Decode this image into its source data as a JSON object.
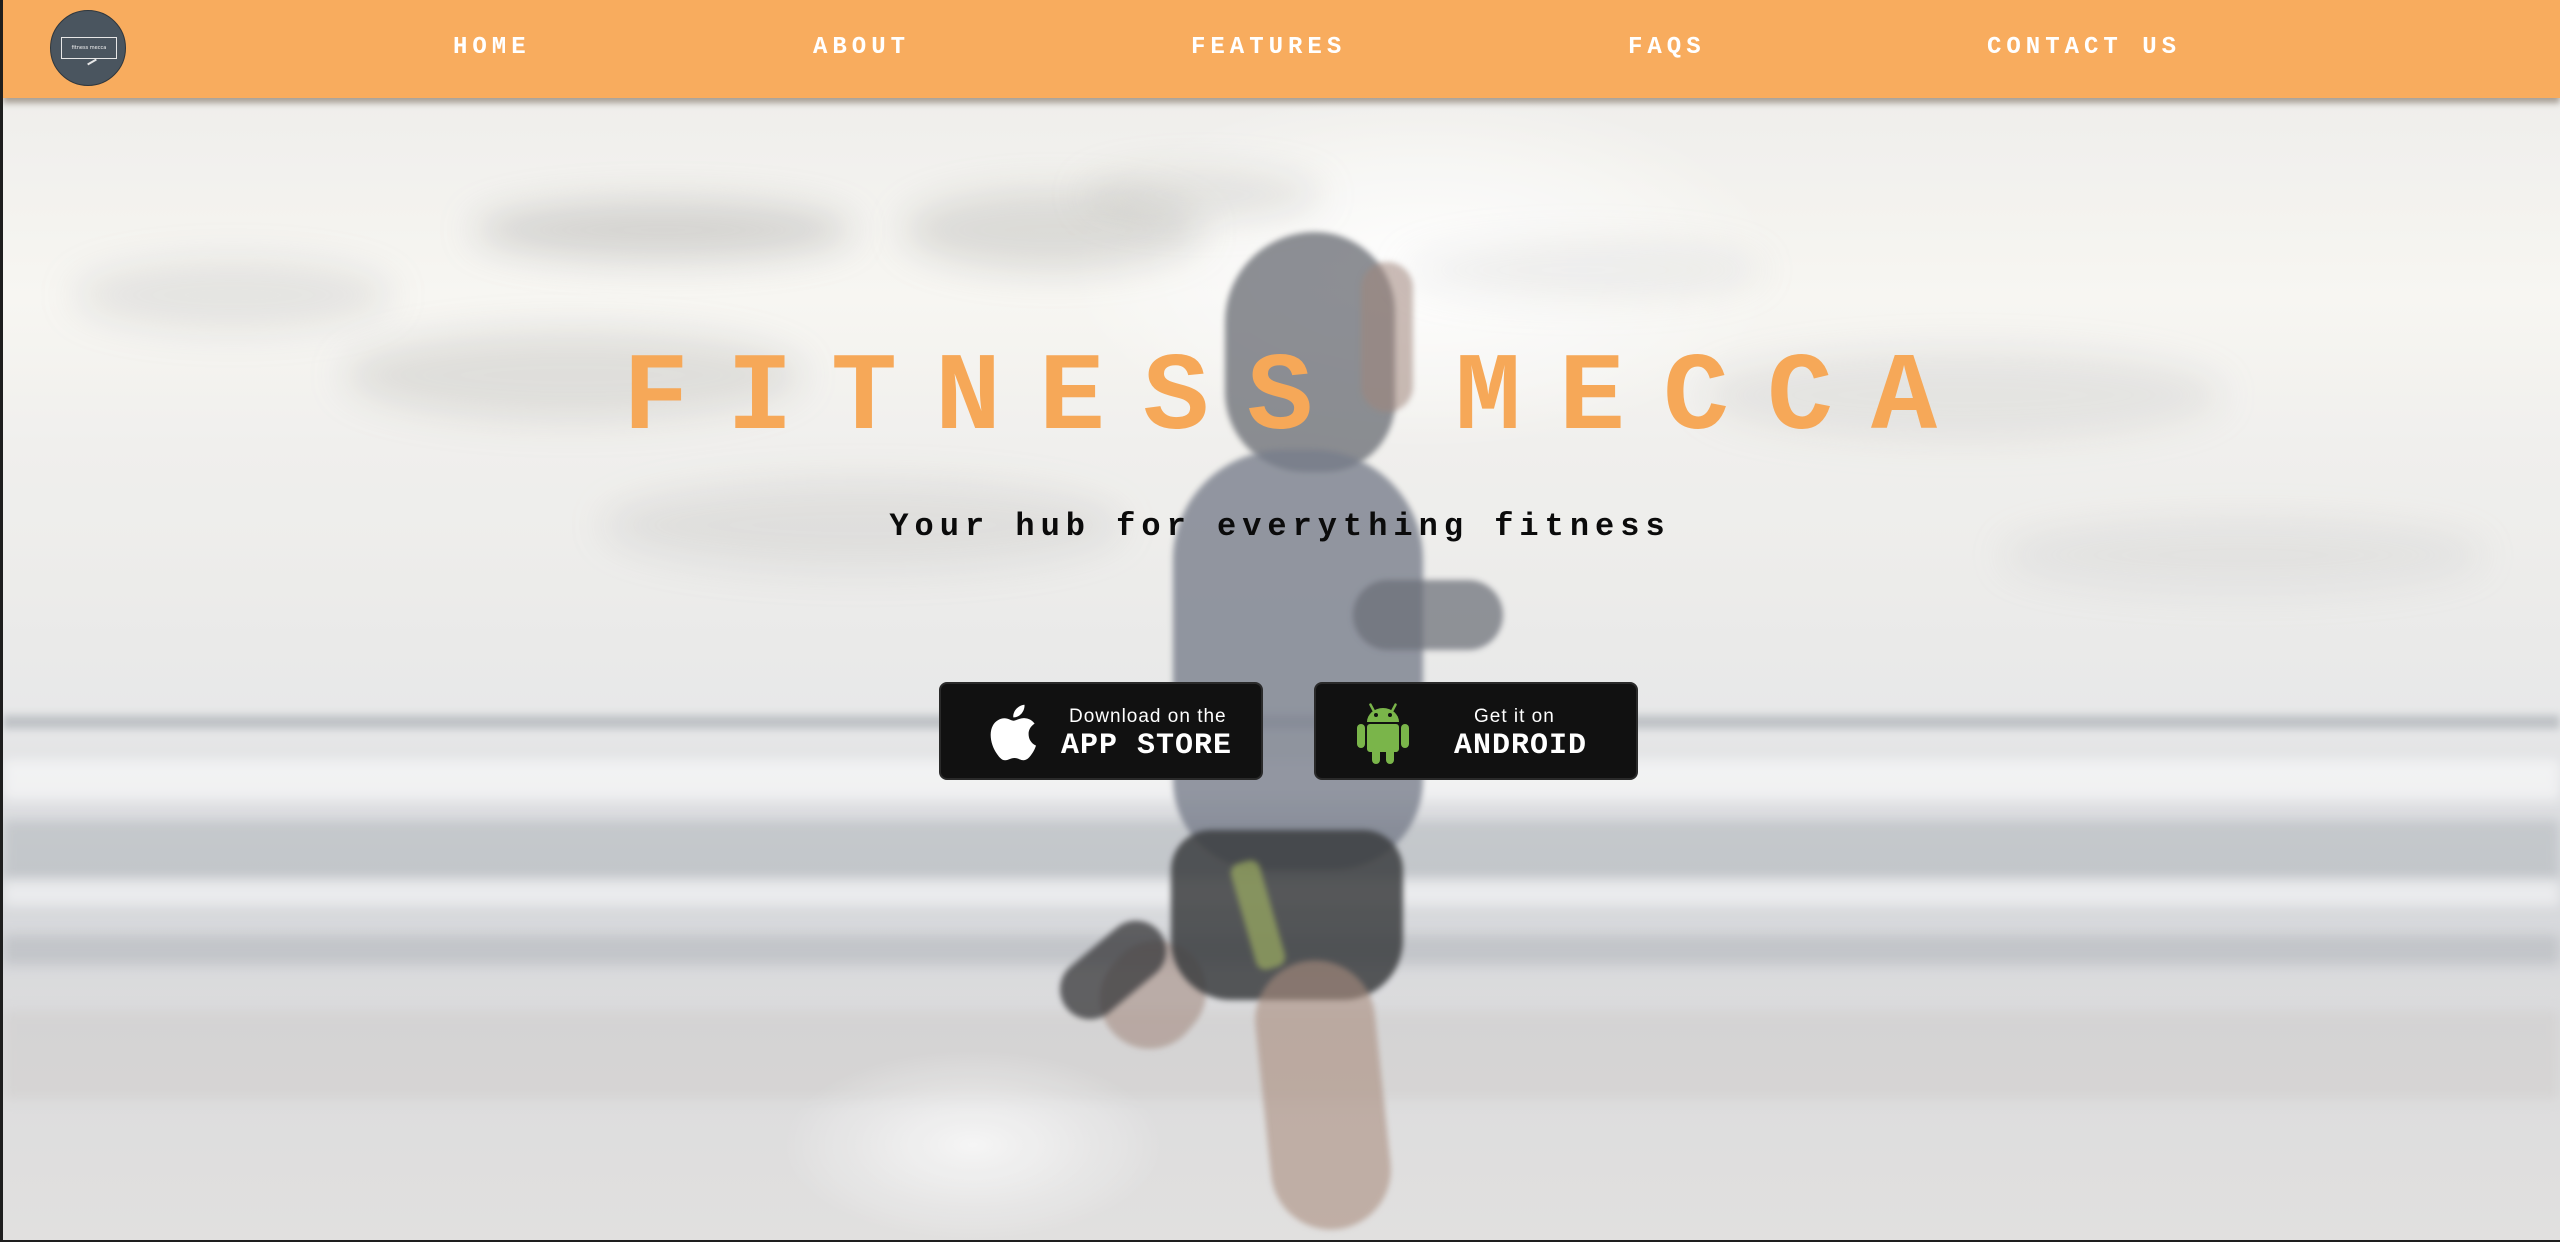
{
  "colors": {
    "navbar_bg": "#f8ac5e",
    "title_color": "#f6a858",
    "subtitle_color": "#0b0b0b",
    "badge_bg": "#111111",
    "android_green": "#7ab54a",
    "logo_bg": "#4a555f"
  },
  "navbar": {
    "logo": {
      "icon": "logo-icon",
      "text": "fitness mecca"
    },
    "links": [
      {
        "label": "HOME"
      },
      {
        "label": "ABOUT"
      },
      {
        "label": "FEATURES"
      },
      {
        "label": "FAQS"
      },
      {
        "label": "CONTACT US"
      }
    ]
  },
  "hero": {
    "title": "FITNESS MECCA",
    "subtitle": "Your hub for everything fitness",
    "background_image": "runner-on-beach-photo",
    "badges": [
      {
        "icon": "apple-icon",
        "small_text": "Download on the",
        "big_text": "APP STORE"
      },
      {
        "icon": "android-icon",
        "small_text": "Get it on",
        "big_text": "ANDROID"
      }
    ]
  }
}
